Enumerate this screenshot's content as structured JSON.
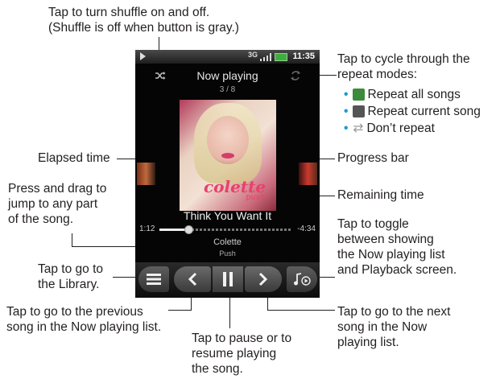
{
  "phone": {
    "status": {
      "network": "3G",
      "time": "11:35"
    },
    "title": "Now playing",
    "track_count": "3 / 8",
    "album_art": {
      "brand": "colette",
      "sub": "push"
    },
    "song": "Think You Want It",
    "elapsed": "1:12",
    "remaining": "-4:34",
    "progress_fraction": 0.21,
    "artist": "Colette",
    "album": "Push",
    "icons": {
      "shuffle": "shuffle-icon",
      "repeat": "repeat-icon",
      "library": "library-menu-icon",
      "previous": "previous-icon",
      "pause": "pause-icon",
      "next": "next-icon",
      "now_playing": "now-playing-list-icon"
    }
  },
  "callouts": {
    "shuffle": [
      "Tap to turn shuffle on and off.",
      "(Shuffle is off when button is gray.)"
    ],
    "repeat": [
      "Tap to cycle through the",
      "repeat modes:"
    ],
    "repeat_modes": [
      "Repeat all songs",
      "Repeat current song",
      "Don’t repeat"
    ],
    "elapsed": [
      "Elapsed time"
    ],
    "drag": [
      "Press and drag to",
      "jump to any part",
      "of the song."
    ],
    "library": [
      "Tap to go to",
      "the Library."
    ],
    "previous": [
      "Tap to go to the previous",
      "song in the Now playing list."
    ],
    "pause": [
      "Tap to pause or to",
      "resume playing",
      "the song."
    ],
    "progress": [
      "Progress bar"
    ],
    "remaining": [
      "Remaining time"
    ],
    "toggle": [
      "Tap to toggle",
      "between showing",
      "the Now playing list",
      "and Playback screen."
    ],
    "next": [
      "Tap to go to the next",
      "song in the Now",
      "playing list."
    ]
  },
  "colors": {
    "bullet": "#1c9ad6",
    "phone_bg": "#050505",
    "battery": "#3fae3f"
  }
}
